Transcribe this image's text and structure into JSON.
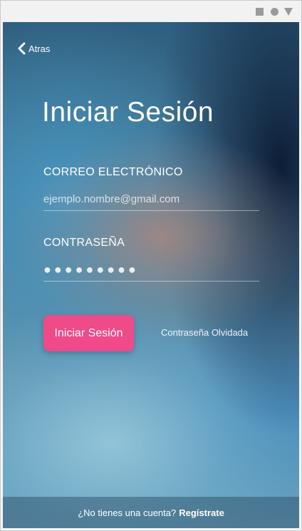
{
  "window": {
    "controls": [
      "square-icon",
      "circle-icon",
      "triangle-down-icon"
    ]
  },
  "header": {
    "back_label": "Atras",
    "back_icon": "chevron-left-icon"
  },
  "title": "Iniciar Sesión",
  "form": {
    "email_label": "CORREO ELECTRÓNICO",
    "email_value": "ejemplo.nombre@gmail.com",
    "password_label": "CONTRASEÑA",
    "password_value": "●●●●●●●●●"
  },
  "actions": {
    "login_label": "Iniciar Sesión",
    "forgot_label": "Contraseña Olvidada"
  },
  "footer": {
    "prompt": "¿No tienes una cuenta?",
    "signup_label": "Regístrate"
  },
  "colors": {
    "accent": "#ef4a8a",
    "text": "#ffffff"
  }
}
